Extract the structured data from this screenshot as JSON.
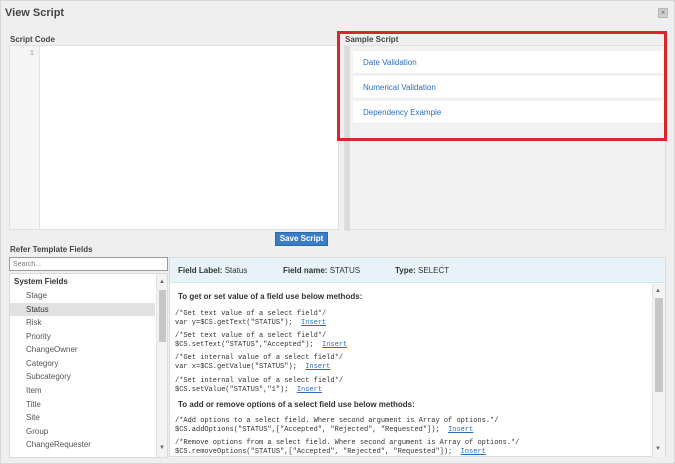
{
  "window": {
    "title": "View Script",
    "close_glyph": "×"
  },
  "script_code": {
    "label": "Script Code",
    "line_number": "1"
  },
  "sample_script": {
    "label": "Sample Script",
    "items": [
      "Date Validation",
      "Numerical Validation",
      "Dependency Example"
    ],
    "highlight_color": "#d9262d"
  },
  "save_button": {
    "label": "Save Script"
  },
  "template_fields": {
    "label": "Refer Template Fields",
    "search_placeholder": "Search...",
    "group_header": "System Fields",
    "items": [
      "Stage",
      "Status",
      "Risk",
      "Priority",
      "ChangeOwner",
      "Category",
      "Subcategory",
      "Item",
      "Title",
      "Site",
      "Group",
      "ChangeRequester"
    ],
    "selected": "Status"
  },
  "field_info": {
    "label_title": "Field Label:",
    "label_value": "Status",
    "name_title": "Field name:",
    "name_value": "STATUS",
    "type_title": "Type:",
    "type_value": "SELECT"
  },
  "methods": {
    "get_set_title": "To get or set value of a field use below methods:",
    "snippets": [
      {
        "comment": "/*Get text value of a select field*/",
        "code": "var y=$CS.getText(\"STATUS\");"
      },
      {
        "comment": "/*Set text value of a select field*/",
        "code": "$CS.setText(\"STATUS\",\"Accepted\");"
      },
      {
        "comment": "/*Get internal value of a select field*/",
        "code": "var x=$CS.getValue(\"STATUS\");"
      },
      {
        "comment": "/*Set internal value of a select field*/",
        "code": "$CS.setValue(\"STATUS\",\"1\");"
      }
    ],
    "options_title": "To add or remove options of a select field use below methods:",
    "option_snippets": [
      {
        "comment": "/*Add options to a select field. Where second argument is Array of options.*/",
        "code": "$CS.addOptions(\"STATUS\",[\"Accepted\", \"Rejected\", \"Requested\"]);"
      },
      {
        "comment": "/*Remove options from a select field. Where second argument is Array of options.*/",
        "code": "$CS.removeOptions(\"STATUS\",[\"Accepted\", \"Rejected\", \"Requested\"]);"
      }
    ],
    "insert_label": "Insert"
  }
}
